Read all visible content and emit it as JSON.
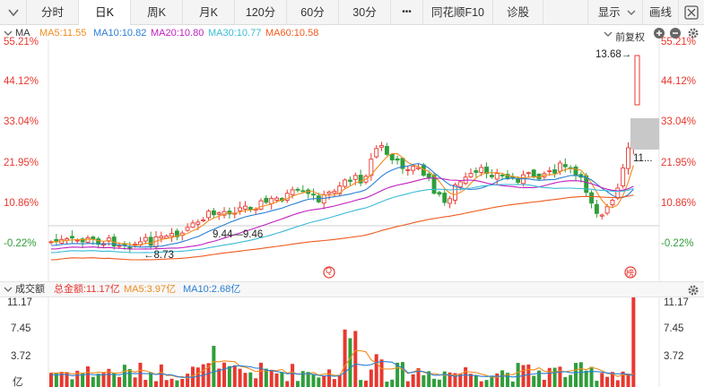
{
  "toolbar": {
    "tabs": [
      "分时",
      "日K",
      "周K",
      "月K",
      "120分",
      "60分",
      "30分"
    ],
    "active_tab": "日K",
    "more_label": "•••",
    "f10_label": "同花顺F10",
    "diagnose_label": "诊股",
    "display_label": "显示",
    "draw_label": "画线"
  },
  "ma_legend": {
    "title": "MA",
    "ma5": "MA5:11.55",
    "ma10": "MA10:10.82",
    "ma20": "MA20:10.80",
    "ma30": "MA30:10.77",
    "ma60": "MA60:10.58",
    "adjust_label": "前复权"
  },
  "price_axis": {
    "left_labels": [
      "55.21%",
      "44.12%",
      "33.04%",
      "21.95%",
      "10.86%",
      "-0.22%"
    ],
    "right_labels": [
      "55.21%",
      "44.12%",
      "33.04%",
      "21.95%",
      "10.86%",
      "-0.22%"
    ]
  },
  "annotations": {
    "high": "13.68→",
    "low": "←8.73",
    "range": "9.44—9.46",
    "last": "11...",
    "marker_q": "Q",
    "marker_bang": "榜"
  },
  "volume_bar": {
    "title": "成交额",
    "total": "总金额:11.17亿",
    "ma5": "MA5:3.97亿",
    "ma10": "MA10:2.68亿"
  },
  "volume_axis": {
    "left_labels": [
      "11.17",
      "7.45",
      "3.72",
      "亿"
    ],
    "right_labels": [
      "11.17",
      "7.45",
      "3.72"
    ]
  },
  "colors": {
    "up": "#e8382f",
    "down": "#2f9e3a",
    "ma5": "#f08c1e",
    "ma10": "#2a7fd4",
    "ma20": "#c01fc0",
    "ma30": "#3bbbd6",
    "ma60": "#f05a1e"
  }
}
